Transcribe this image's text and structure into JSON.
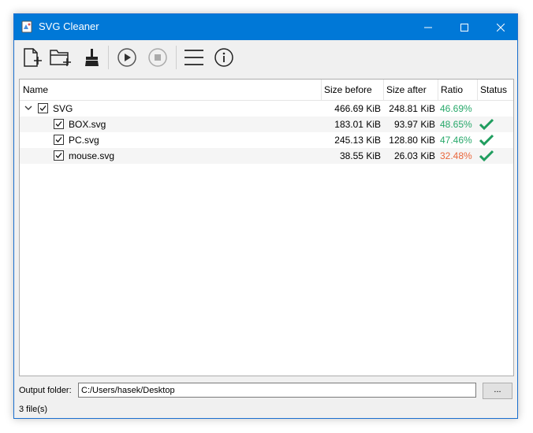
{
  "window": {
    "title": "SVG Cleaner"
  },
  "toolbar": {
    "icons": [
      "add-file-icon",
      "add-folder-icon",
      "clear-icon",
      "play-icon",
      "stop-icon",
      "menu-icon",
      "info-icon"
    ]
  },
  "columns": {
    "name": "Name",
    "size_before": "Size before",
    "size_after": "Size after",
    "ratio": "Ratio",
    "status": "Status"
  },
  "rows": [
    {
      "name": "SVG",
      "size_before": "466.69 KiB",
      "size_after": "248.81 KiB",
      "ratio": "46.69%",
      "ratio_color": "#27a86a",
      "status": "",
      "checked": true,
      "is_folder": true
    },
    {
      "name": "BOX.svg",
      "size_before": "183.01 KiB",
      "size_after": "93.97 KiB",
      "ratio": "48.65%",
      "ratio_color": "#27a86a",
      "status": "check-icon",
      "checked": true
    },
    {
      "name": "PC.svg",
      "size_before": "245.13 KiB",
      "size_after": "128.80 KiB",
      "ratio": "47.46%",
      "ratio_color": "#27a86a",
      "status": "check-icon",
      "checked": true
    },
    {
      "name": "mouse.svg",
      "size_before": "38.55 KiB",
      "size_after": "26.03 KiB",
      "ratio": "32.48%",
      "ratio_color": "#e9673c",
      "status": "check-icon",
      "checked": true
    }
  ],
  "output": {
    "label": "Output folder:",
    "path": "C:/Users/hasek/Desktop",
    "browse_label": "..."
  },
  "statusbar": {
    "text": "3 file(s)"
  },
  "colors": {
    "titlebar": "#0078d7",
    "good": "#27a86a",
    "bad": "#e9673c"
  }
}
